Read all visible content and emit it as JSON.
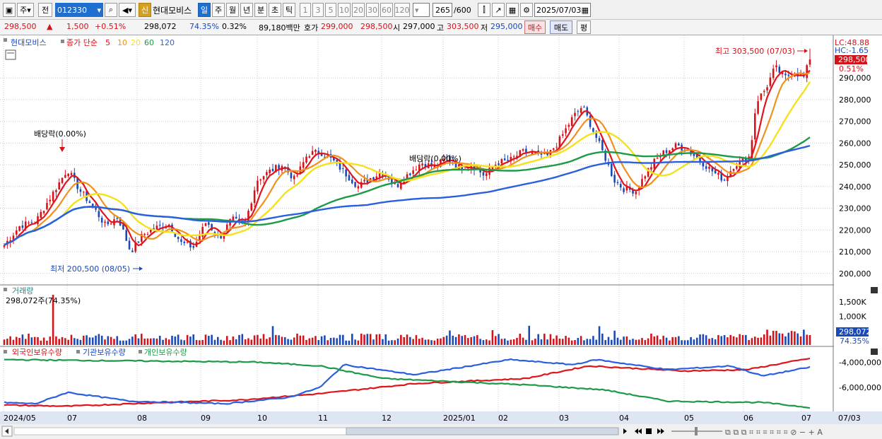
{
  "toolbar": {
    "market_label": "주",
    "prev_label": "전",
    "code_value": "012330",
    "new_badge": "신",
    "stock_name": "현대모비스",
    "period_tabs": [
      "일",
      "주",
      "월",
      "년",
      "분",
      "초",
      "틱"
    ],
    "active_period": "일",
    "minute_options": [
      "1",
      "3",
      "5",
      "10",
      "20",
      "30",
      "60",
      "120"
    ],
    "count_value": "265",
    "count_max": "/600",
    "date_value": "2025/07/03"
  },
  "quote": {
    "price": "298,500",
    "up_arrow": "▲",
    "change": "1,500",
    "change_pct": "+0.51%",
    "volume": "298,072",
    "volume_ratio": "74.35%",
    "turnover_pct": "0.32%",
    "amount": "89,180백만",
    "hoga_label": "호가",
    "bid": "299,000",
    "ask": "298,500",
    "open_label": "시",
    "open": "297,000",
    "high_label": "고",
    "high": "303,500",
    "low_label": "저",
    "low": "295,000",
    "buy_label": "매수",
    "sell_label": "매도",
    "even_label": "평"
  },
  "price_panel": {
    "legend_name": "현대모비스",
    "legend_ma": "종가 단순",
    "ma_periods": [
      "5",
      "10",
      "20",
      "60",
      "120"
    ],
    "ma_colors": [
      "#e0141b",
      "#f0911e",
      "#f4e21d",
      "#1d9a48",
      "#2a5fe0"
    ],
    "lc_text": "LC:48.88",
    "hc_text": "HC:-1.65",
    "last_price_tag": "298,500",
    "last_pct_tag": "0.51%",
    "high_note": "최고 303,500 (07/03)",
    "low_note": "최저 200,500 (08/05)",
    "dividend_note_1": "배당락(0.00%)",
    "dividend_note_2": "배당락(0.00%)",
    "y_ticks": [
      "290,000",
      "280,000",
      "270,000",
      "260,000",
      "250,000",
      "240,000",
      "230,000",
      "220,000",
      "210,000",
      "200,000"
    ],
    "y_values": [
      290000,
      280000,
      270000,
      260000,
      250000,
      240000,
      230000,
      220000,
      210000,
      200000
    ]
  },
  "volume_panel": {
    "title": "거래량",
    "value_text": "298,072주(74.35%)",
    "y_ticks": [
      "1,500K",
      "1,000K"
    ],
    "y_values": [
      1500,
      1000
    ],
    "last_tag": "298,072",
    "last_pct": "74.35%"
  },
  "holding_panel": {
    "legend": [
      "외국인보유수량",
      "기관보유수량",
      "개인보유수량"
    ],
    "colors": [
      "#e0141b",
      "#2a5fe0",
      "#1d9a48"
    ],
    "y_ticks": [
      "-4,000,000",
      "-6,000,000"
    ],
    "y_values": [
      -4000000,
      -6000000
    ]
  },
  "x_axis": {
    "labels": [
      "2024/05",
      "07",
      "08",
      "09",
      "10",
      "11",
      "12",
      "2025/01",
      "02",
      "03",
      "04",
      "05",
      "06",
      "07"
    ],
    "right_label": "07/03"
  },
  "chart_data": {
    "type": "candlestick",
    "period": "daily",
    "bars": 265,
    "high": {
      "value": 303500,
      "date": "07/03"
    },
    "low": {
      "value": 200500,
      "date": "08/05"
    },
    "last_close": 298500,
    "ylim": [
      197000,
      307000
    ],
    "close_anchors": [
      [
        0,
        213000
      ],
      [
        10,
        222000
      ],
      [
        20,
        224000
      ],
      [
        30,
        236000
      ],
      [
        40,
        248000
      ],
      [
        48,
        238000
      ],
      [
        56,
        231000
      ],
      [
        64,
        222000
      ],
      [
        72,
        226000
      ],
      [
        80,
        210000
      ],
      [
        88,
        218000
      ],
      [
        96,
        221000
      ],
      [
        104,
        223000
      ],
      [
        112,
        214000
      ],
      [
        120,
        212000
      ],
      [
        128,
        224000
      ],
      [
        136,
        216000
      ],
      [
        144,
        225000
      ],
      [
        152,
        222000
      ],
      [
        160,
        243000
      ],
      [
        168,
        247000
      ],
      [
        176,
        250000
      ],
      [
        184,
        243000
      ],
      [
        192,
        255000
      ],
      [
        200,
        256000
      ],
      [
        208,
        252000
      ],
      [
        216,
        246000
      ],
      [
        224,
        240000
      ],
      [
        232,
        244000
      ],
      [
        240,
        247000
      ],
      [
        248,
        240000
      ],
      [
        256,
        246000
      ],
      [
        264,
        251000
      ],
      [
        272,
        249000
      ],
      [
        280,
        253000
      ],
      [
        288,
        249000
      ],
      [
        296,
        250000
      ],
      [
        304,
        245000
      ],
      [
        312,
        251000
      ],
      [
        320,
        252000
      ],
      [
        328,
        256000
      ],
      [
        336,
        255000
      ],
      [
        344,
        254000
      ],
      [
        352,
        262000
      ],
      [
        360,
        272000
      ],
      [
        366,
        277000
      ],
      [
        372,
        267000
      ],
      [
        380,
        254000
      ],
      [
        386,
        243000
      ],
      [
        392,
        239000
      ],
      [
        400,
        238000
      ],
      [
        406,
        246000
      ],
      [
        412,
        252000
      ],
      [
        418,
        256000
      ],
      [
        426,
        259000
      ],
      [
        434,
        256000
      ],
      [
        442,
        251000
      ],
      [
        450,
        246000
      ],
      [
        456,
        243000
      ],
      [
        462,
        250000
      ],
      [
        468,
        252000
      ],
      [
        472,
        254000
      ],
      [
        476,
        279000
      ],
      [
        482,
        285000
      ],
      [
        488,
        295000
      ],
      [
        494,
        290000
      ],
      [
        500,
        293000
      ],
      [
        506,
        290000
      ],
      [
        510,
        298500
      ]
    ],
    "moving_averages": [
      5,
      10,
      20,
      60,
      120
    ],
    "holding_series": [
      "외국인보유수량",
      "기관보유수량",
      "개인보유수량"
    ]
  }
}
